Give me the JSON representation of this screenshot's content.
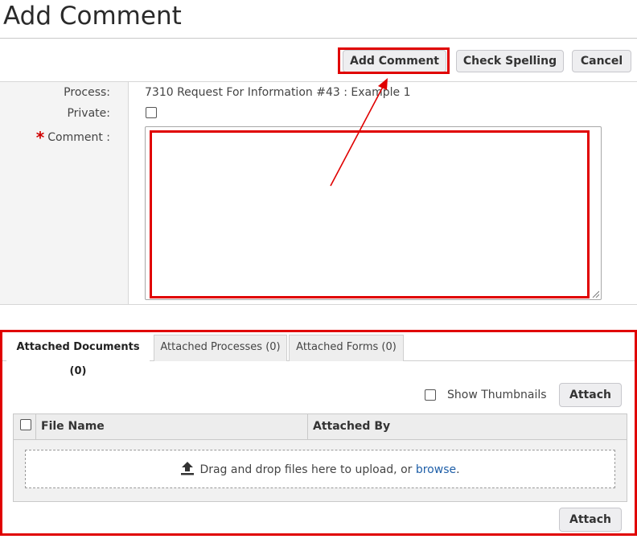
{
  "page": {
    "title": "Add Comment"
  },
  "toolbar": {
    "add_comment_label": "Add Comment",
    "check_spelling_label": "Check Spelling",
    "cancel_label": "Cancel"
  },
  "form": {
    "process_label": "Process:",
    "process_value": "7310 Request For Information #43  :  Example 1",
    "private_label": "Private:",
    "private_checked": false,
    "comment_required_marker": "*",
    "comment_label": "Comment :",
    "comment_value": ""
  },
  "attachments": {
    "tabs": [
      {
        "label": "Attached Documents (0)",
        "active": true
      },
      {
        "label": "Attached Processes (0)",
        "active": false
      },
      {
        "label": "Attached Forms (0)",
        "active": false
      }
    ],
    "show_thumbnails_label": "Show Thumbnails",
    "show_thumbnails_checked": false,
    "attach_label": "Attach",
    "columns": [
      "File Name",
      "Attached By"
    ],
    "dropzone_text": "Drag and drop files here to upload, or ",
    "dropzone_link": "browse",
    "dropzone_suffix": ".",
    "bottom_attach_label": "Attach"
  },
  "colors": {
    "highlight": "#e00000",
    "link": "#1f5fa8"
  },
  "icons": {
    "upload": "upload-icon",
    "resize": "resize-grip-icon"
  }
}
